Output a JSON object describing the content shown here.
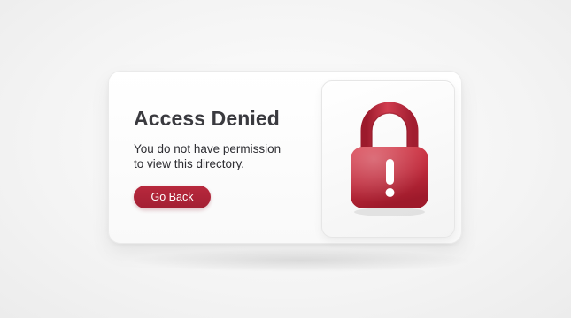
{
  "dialog": {
    "title": "Access Denied",
    "message_line1": "You do not have permission",
    "message_line2": "to view this directory.",
    "back_button_label": "Go Back",
    "icon": "lock-icon",
    "accent_color": "#b0263b"
  }
}
